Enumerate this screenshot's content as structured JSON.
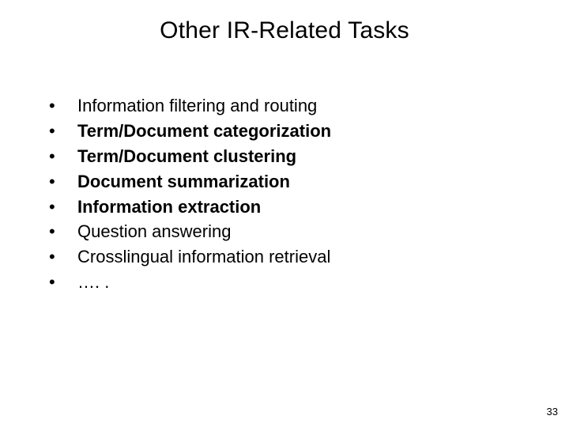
{
  "title": "Other IR-Related Tasks",
  "bullets": [
    {
      "text": "Information filtering and routing",
      "bold": false
    },
    {
      "text": "Term/Document categorization",
      "bold": true
    },
    {
      "text": "Term/Document clustering",
      "bold": true
    },
    {
      "text": "Document summarization",
      "bold": true
    },
    {
      "text": "Information extraction",
      "bold": true
    },
    {
      "text": "Question answering",
      "bold": false
    },
    {
      "text": "Crosslingual information retrieval",
      "bold": false
    },
    {
      "text": "…. .",
      "bold": false
    }
  ],
  "bullet_char": "•",
  "page_number": "33"
}
